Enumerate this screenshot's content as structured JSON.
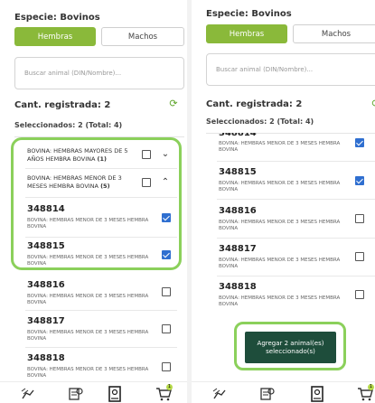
{
  "species_label": "Especie: Bovinos",
  "tabs": {
    "hembras": "Hembras",
    "machos": "Machos"
  },
  "search_placeholder": "Buscar animal (DIN/Nombre)...",
  "count_label": "Cant. registrada: 2",
  "selected_label": "Seleccionados: 2 (Total: 4)",
  "groups": [
    {
      "title": "BOVINA: HEMBRAS MAYORES DE 5 AÑOS HEMBRA BOVINA",
      "count": "(1)"
    },
    {
      "title": "BOVINA: HEMBRAS MENOR DE 3 MESES HEMBRA BOVINA",
      "count": "(5)"
    }
  ],
  "item_desc": "BOVINA: HEMBRAS MENOR DE 3 MESES HEMBRA BOVINA",
  "items": [
    "348814",
    "348815",
    "348816",
    "348817",
    "348818"
  ],
  "partial_id": "348814",
  "add_button": "Agregar 2 animal(es) seleccionado(s)",
  "cart_badge": "1",
  "colors": {
    "accent_green": "#8ab93a",
    "highlight": "#8bd05b",
    "button_dark": "#1e4d3b",
    "check_blue": "#2f6fd0"
  },
  "nav_icons": [
    "animal-transfer-icon",
    "map-pin-document-icon",
    "id-card-icon",
    "cart-icon"
  ]
}
